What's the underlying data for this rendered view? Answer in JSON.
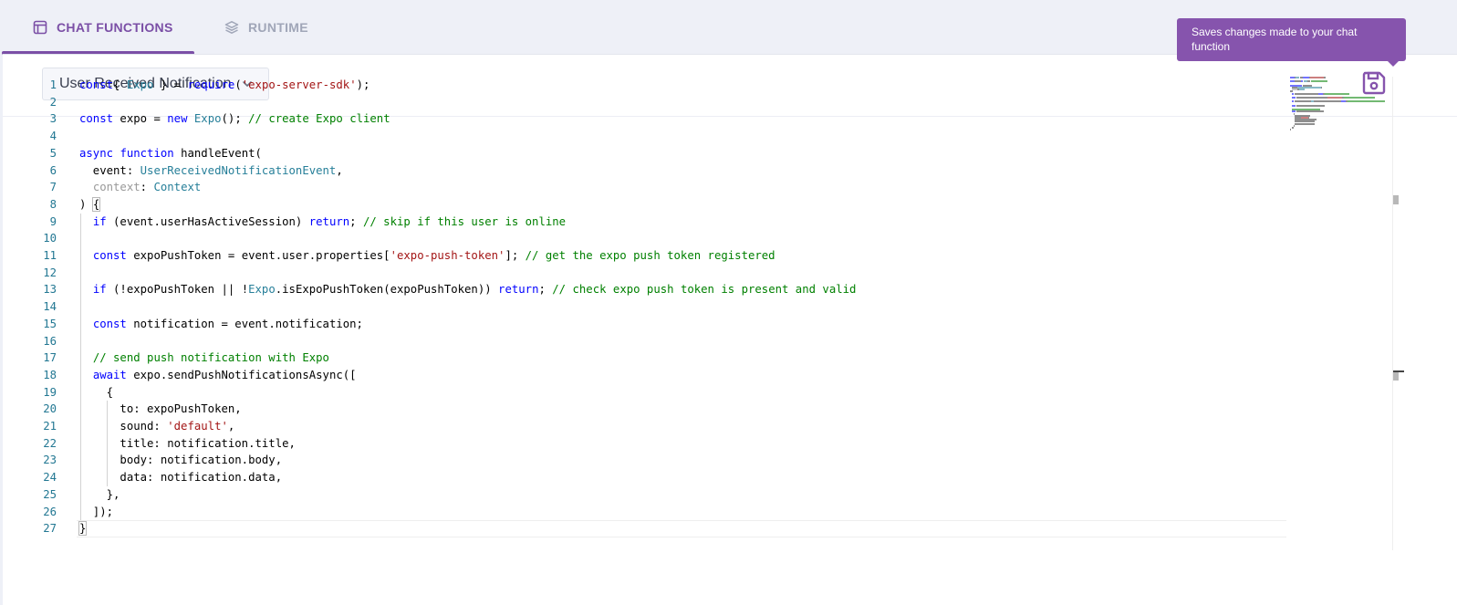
{
  "tabs": [
    {
      "label": "CHAT FUNCTIONS",
      "icon": "window-icon",
      "active": true
    },
    {
      "label": "RUNTIME",
      "icon": "layers-icon",
      "active": false
    }
  ],
  "toolbar": {
    "function_select": "User Received Notification",
    "save_tooltip": "Saves changes made to your chat function",
    "save_icon": "floppy-disk-icon"
  },
  "colors": {
    "accent": "#7b4fa6",
    "tooltip_bg": "#8654ad",
    "keyword": "#0000ff",
    "type": "#267f99",
    "string": "#a31515",
    "comment": "#008000",
    "line_number": "#237893"
  },
  "code_lines": [
    [
      [
        "kw",
        "const"
      ],
      [
        "",
        "{ "
      ],
      [
        "ty",
        "Expo"
      ],
      [
        "",
        " } = "
      ],
      [
        "kw",
        "require"
      ],
      [
        "",
        "("
      ],
      [
        "st",
        "'expo-server-sdk'"
      ],
      [
        "",
        ");"
      ]
    ],
    [],
    [
      [
        "kw",
        "const"
      ],
      [
        "",
        " expo = "
      ],
      [
        "kw",
        "new"
      ],
      [
        "",
        " "
      ],
      [
        "ty",
        "Expo"
      ],
      [
        "",
        "(); "
      ],
      [
        "cm",
        "// create Expo client"
      ]
    ],
    [],
    [
      [
        "kw",
        "async"
      ],
      [
        "",
        " "
      ],
      [
        "kw",
        "function"
      ],
      [
        "",
        " handleEvent("
      ]
    ],
    [
      [
        "",
        "  event: "
      ],
      [
        "ty",
        "UserReceivedNotificationEvent"
      ],
      [
        "",
        ","
      ]
    ],
    [
      [
        "",
        "  "
      ],
      [
        "dim",
        "context"
      ],
      [
        "",
        ": "
      ],
      [
        "ty",
        "Context"
      ]
    ],
    [
      [
        "",
        ") "
      ],
      [
        "br",
        "{"
      ]
    ],
    [
      [
        "",
        "  "
      ],
      [
        "kw",
        "if"
      ],
      [
        "",
        " (event.userHasActiveSession) "
      ],
      [
        "kw",
        "return"
      ],
      [
        "",
        "; "
      ],
      [
        "cm",
        "// skip if this user is online"
      ]
    ],
    [],
    [
      [
        "",
        "  "
      ],
      [
        "kw",
        "const"
      ],
      [
        "",
        " expoPushToken = event.user.properties["
      ],
      [
        "st",
        "'expo-push-token'"
      ],
      [
        "",
        "]; "
      ],
      [
        "cm",
        "// get the expo push token registered"
      ]
    ],
    [],
    [
      [
        "",
        "  "
      ],
      [
        "kw",
        "if"
      ],
      [
        "",
        " (!expoPushToken || !"
      ],
      [
        "ty",
        "Expo"
      ],
      [
        "",
        ".isExpoPushToken(expoPushToken)) "
      ],
      [
        "kw",
        "return"
      ],
      [
        "",
        "; "
      ],
      [
        "cm",
        "// check expo push token is present and valid"
      ]
    ],
    [],
    [
      [
        "",
        "  "
      ],
      [
        "kw",
        "const"
      ],
      [
        "",
        " notification = event.notification;"
      ]
    ],
    [],
    [
      [
        "",
        "  "
      ],
      [
        "cm",
        "// send push notification with Expo"
      ]
    ],
    [
      [
        "",
        "  "
      ],
      [
        "kw",
        "await"
      ],
      [
        "",
        " expo.sendPushNotificationsAsync(["
      ]
    ],
    [
      [
        "",
        "    {"
      ]
    ],
    [
      [
        "",
        "      to: expoPushToken,"
      ]
    ],
    [
      [
        "",
        "      sound: "
      ],
      [
        "st",
        "'default'"
      ],
      [
        "",
        ","
      ]
    ],
    [
      [
        "",
        "      title: notification.title,"
      ]
    ],
    [
      [
        "",
        "      body: notification.body,"
      ]
    ],
    [
      [
        "",
        "      data: notification.data,"
      ]
    ],
    [
      [
        "",
        "    },"
      ]
    ],
    [
      [
        "",
        "  ]);"
      ]
    ],
    [
      [
        "br",
        "}"
      ]
    ]
  ]
}
